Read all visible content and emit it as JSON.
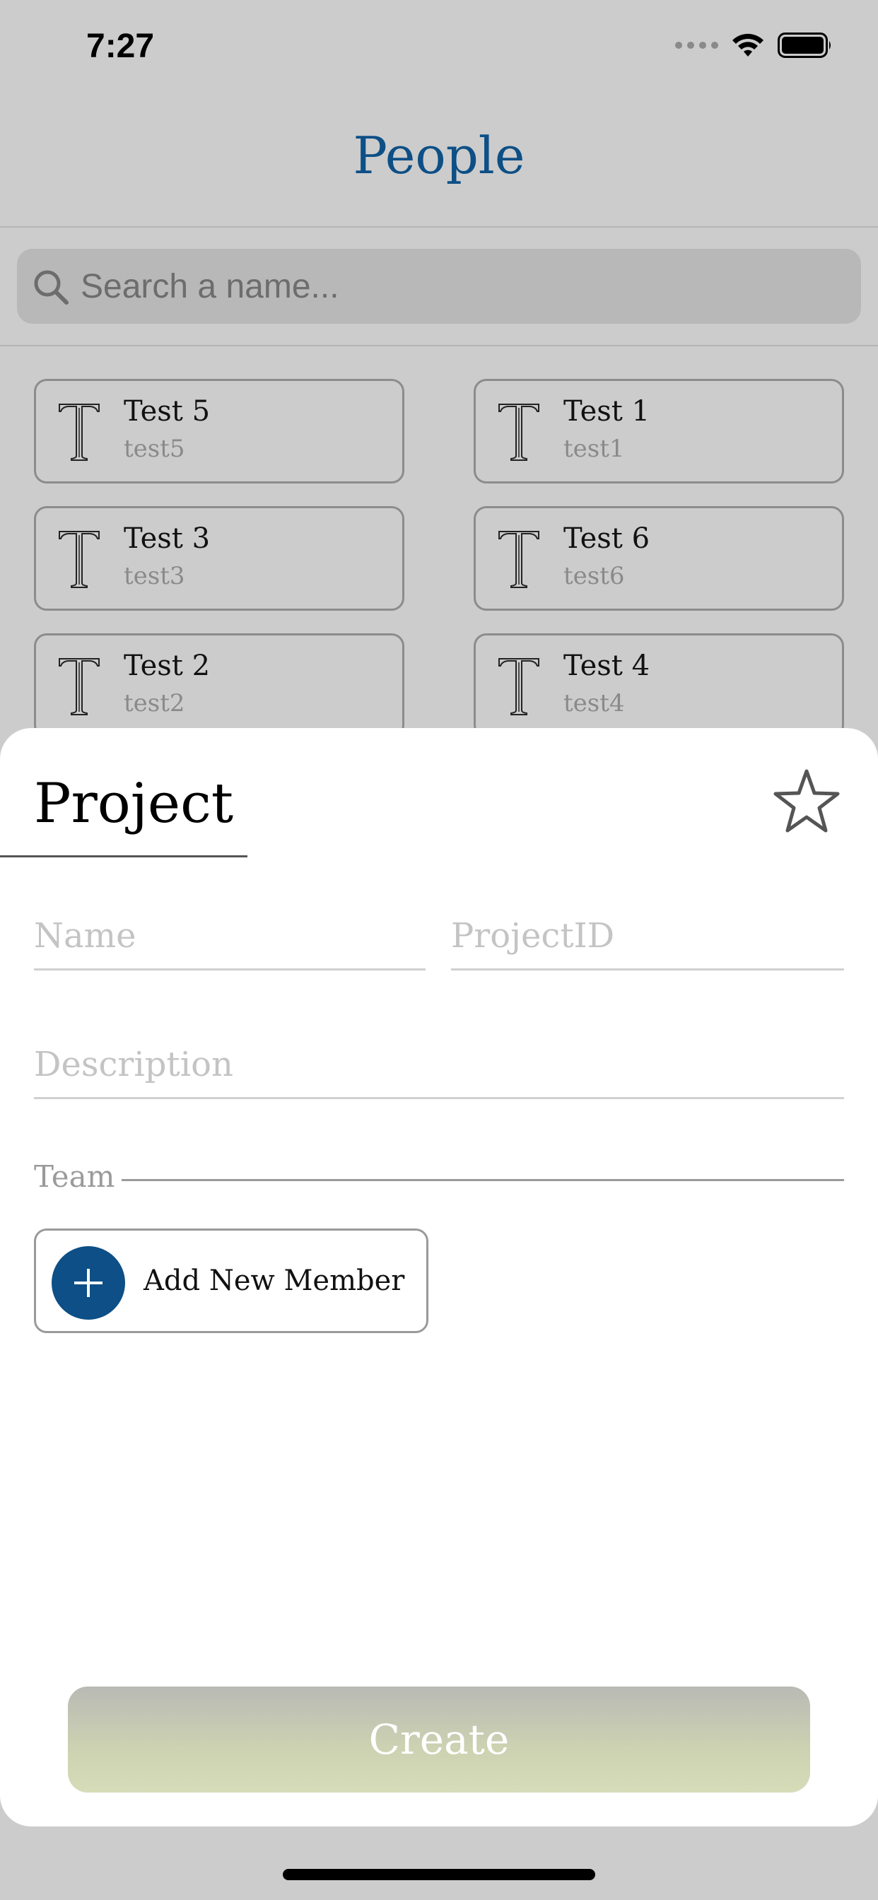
{
  "status_bar": {
    "time": "7:27",
    "icons": [
      "signal-dots-icon",
      "wifi-icon",
      "battery-icon"
    ]
  },
  "header": {
    "title": "People"
  },
  "search": {
    "placeholder": "Search a name...",
    "value": ""
  },
  "people": [
    {
      "name": "Test 5",
      "username": "test5",
      "avatar_letter": "T"
    },
    {
      "name": "Test 1",
      "username": "test1",
      "avatar_letter": "T"
    },
    {
      "name": "Test 3",
      "username": "test3",
      "avatar_letter": "T"
    },
    {
      "name": "Test 6",
      "username": "test6",
      "avatar_letter": "T"
    },
    {
      "name": "Test 2",
      "username": "test2",
      "avatar_letter": "T"
    },
    {
      "name": "Test 4",
      "username": "test4",
      "avatar_letter": "T"
    }
  ],
  "project_sheet": {
    "title": "Project",
    "favorite_icon": "star-outline-icon",
    "name_field": {
      "placeholder": "Name",
      "value": ""
    },
    "project_id_field": {
      "placeholder": "ProjectID",
      "value": ""
    },
    "description_field": {
      "placeholder": "Description",
      "value": ""
    },
    "team_label": "Team",
    "add_member_label": "Add New Member",
    "create_label": "Create"
  },
  "colors": {
    "accent": "#0d4f86",
    "background": "#cccccc",
    "sheet": "#ffffff"
  }
}
